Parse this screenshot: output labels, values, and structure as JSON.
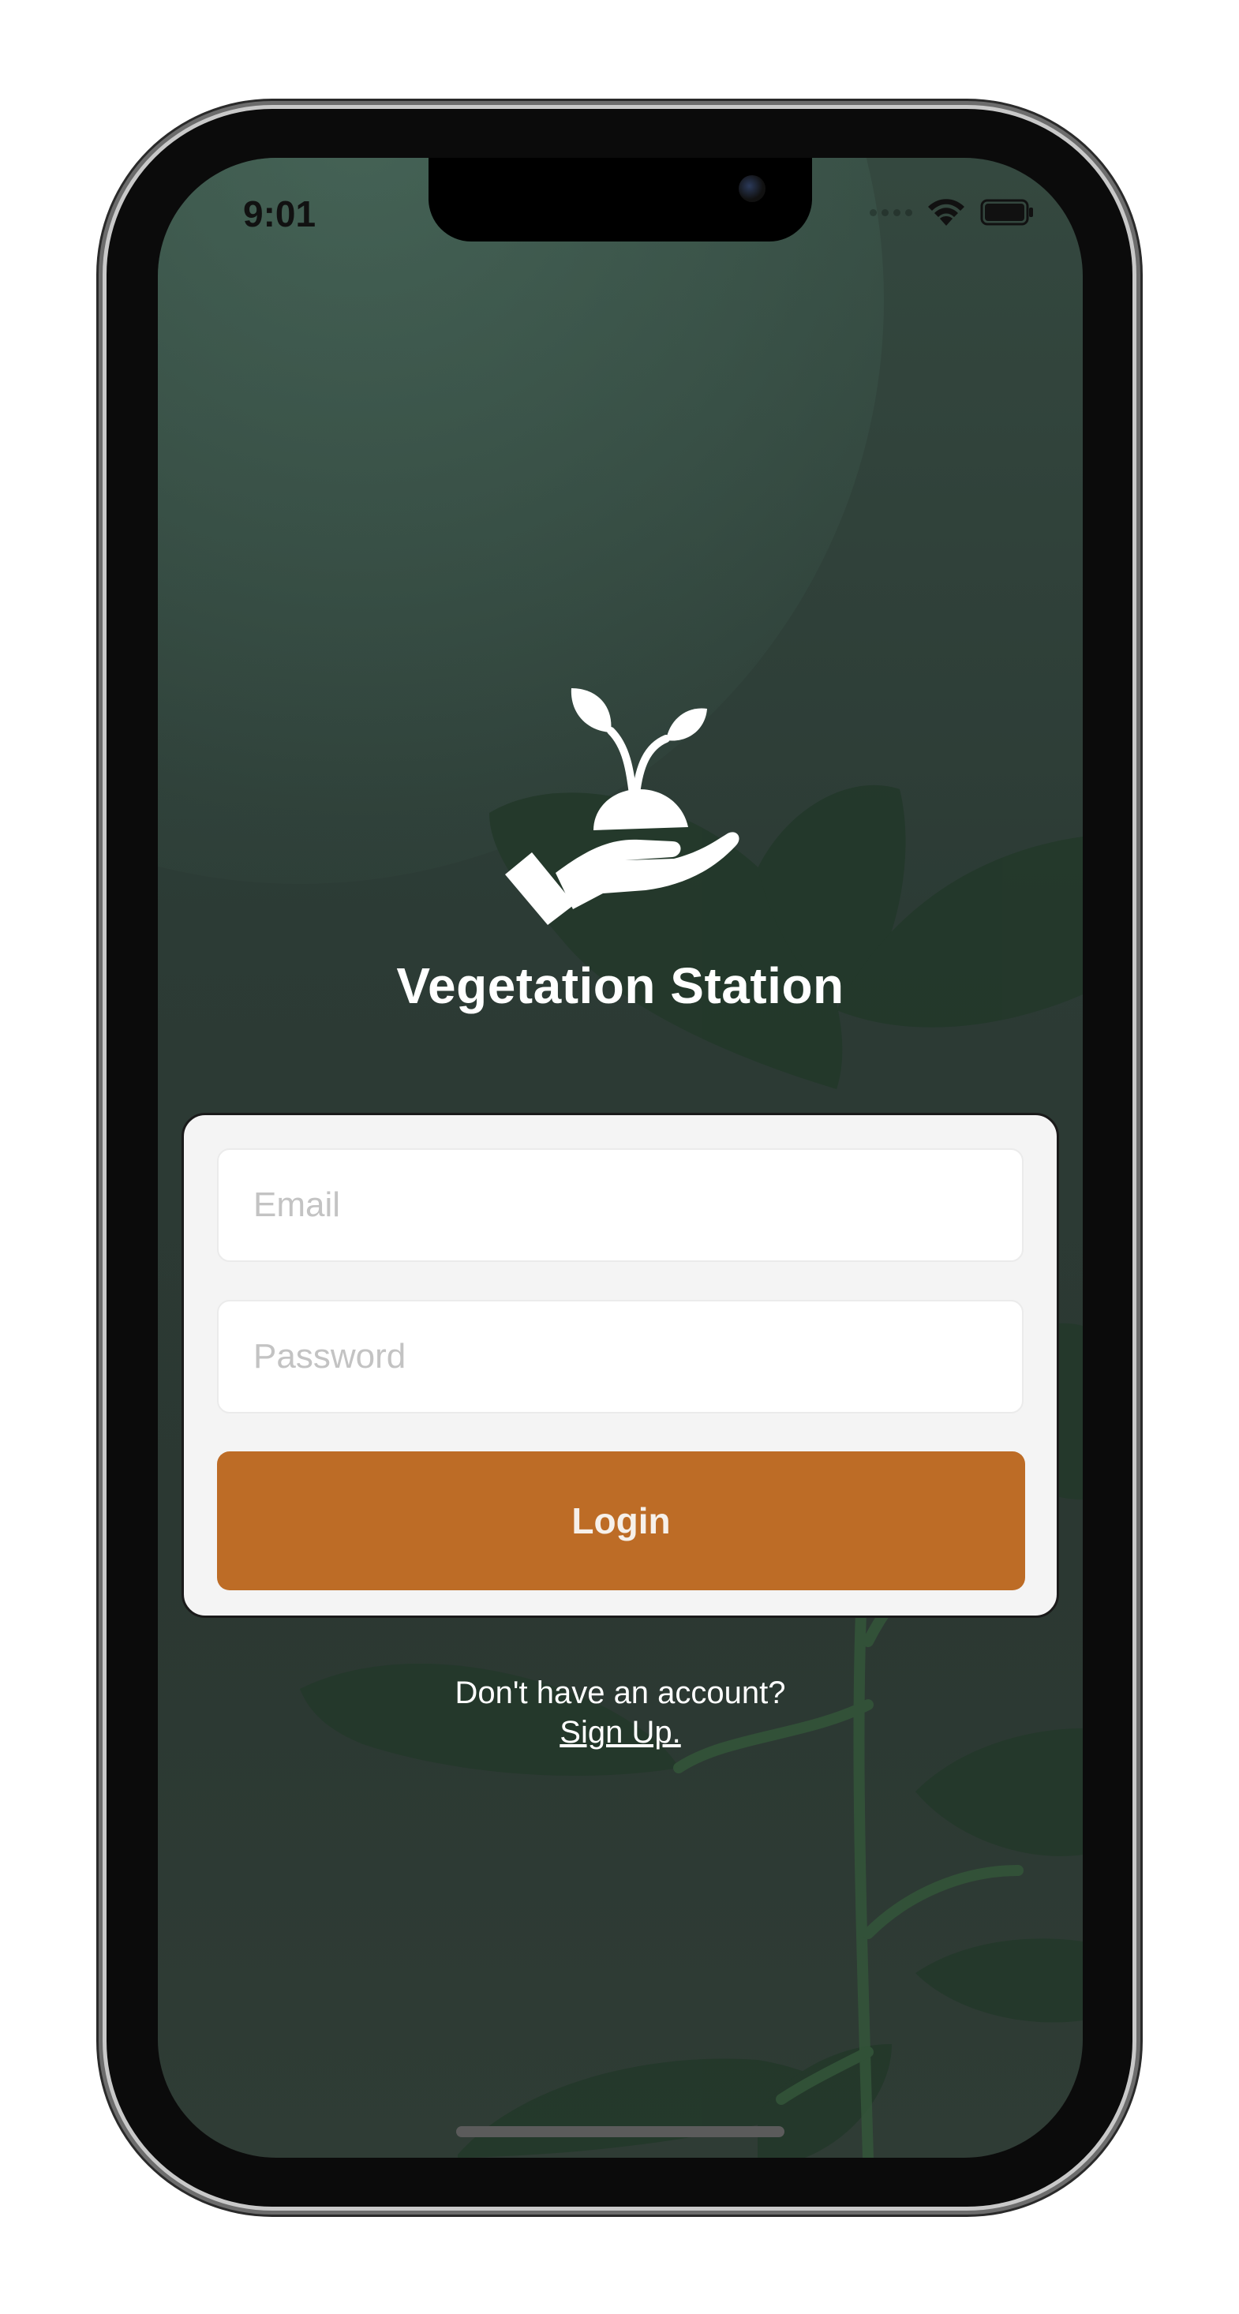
{
  "status_bar": {
    "time": "9:01",
    "icons": [
      "signal-icon",
      "wifi-icon",
      "battery-icon"
    ]
  },
  "brand": {
    "icon": "hand-holding-sprout-icon",
    "title": "Vegetation Station"
  },
  "login_form": {
    "email_placeholder": "Email",
    "password_placeholder": "Password",
    "login_label": "Login"
  },
  "signup": {
    "prompt": "Don't have an account?",
    "link_label": "Sign Up."
  },
  "colors": {
    "accent": "#bd6c26",
    "background": "#2c3b35",
    "card": "#f4f4f4"
  }
}
